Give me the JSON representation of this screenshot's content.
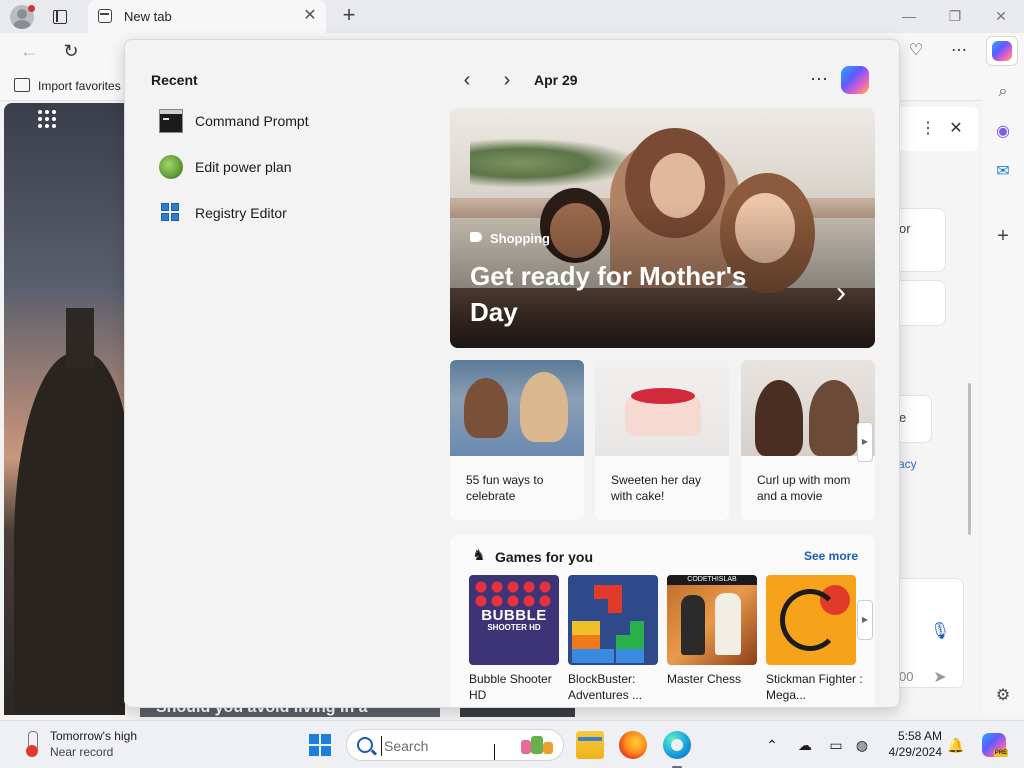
{
  "browser": {
    "tab_title": "New tab",
    "favorites_bar": {
      "import_label": "Import favorites"
    }
  },
  "side_pane": {
    "partial_text_1": "or",
    "partial_text_2": "e",
    "partial_link": "acy",
    "partial_number": "00"
  },
  "background_page": {
    "headline_partial": "Should you avoid living in a"
  },
  "widgets": {
    "recent": {
      "title": "Recent",
      "items": [
        {
          "label": "Command Prompt",
          "icon": "command-prompt-icon"
        },
        {
          "label": "Edit power plan",
          "icon": "power-plan-icon"
        },
        {
          "label": "Registry Editor",
          "icon": "registry-editor-icon"
        }
      ]
    },
    "date": "Apr 29",
    "feature": {
      "category": "Shopping",
      "title": "Get ready for Mother's Day"
    },
    "cards": [
      {
        "text": "55 fun ways to celebrate"
      },
      {
        "text": "Sweeten her day with cake!"
      },
      {
        "text": "Curl up with mom and a movie"
      }
    ],
    "games": {
      "title": "Games for you",
      "see_more": "See more",
      "items": [
        {
          "label": "Bubble Shooter HD",
          "thumb_text": "BUBBLE",
          "thumb_sub": "SHOOTER HD"
        },
        {
          "label": "BlockBuster: Adventures ..."
        },
        {
          "label": "Master Chess",
          "thumb_tag": "CODETHISLAB"
        },
        {
          "label": "Stickman Fighter : Mega..."
        }
      ]
    }
  },
  "taskbar": {
    "weather": {
      "title": "Tomorrow's high",
      "subtitle": "Near record"
    },
    "search": {
      "placeholder": "Search"
    },
    "clock": {
      "time": "5:58 AM",
      "date": "4/29/2024"
    },
    "copilot_badge": "PRE"
  }
}
